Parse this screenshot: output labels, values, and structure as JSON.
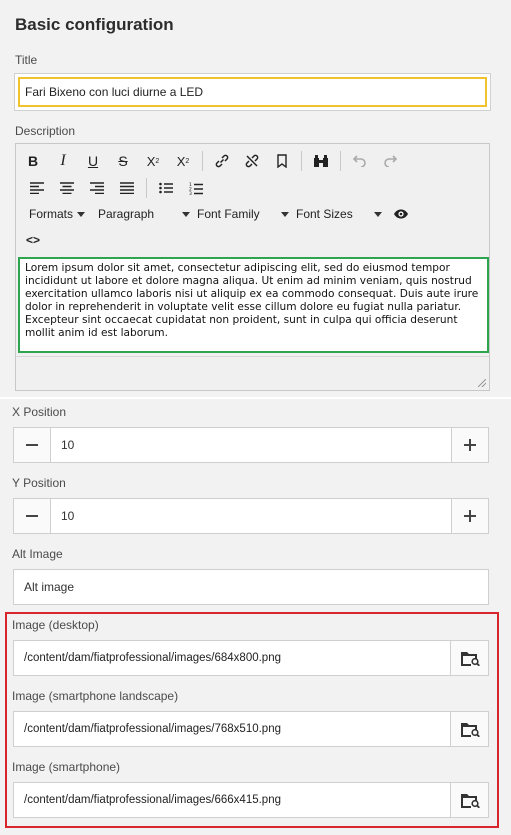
{
  "heading": "Basic configuration",
  "title_field": {
    "label": "Title",
    "value": "Fari Bixeno con luci diurne a LED"
  },
  "description": {
    "label": "Description",
    "toolbar": {
      "formats": "Formats",
      "paragraph": "Paragraph",
      "font_family": "Font Family",
      "font_sizes": "Font Sizes",
      "code": "<>"
    },
    "body": "Lorem ipsum dolor sit amet, consectetur adipiscing elit, sed do eiusmod tempor incididunt ut labore et dolore magna aliqua. Ut enim ad minim veniam, quis nostrud exercitation ullamco laboris nisi ut aliquip ex ea commodo consequat. Duis aute irure dolor in reprehenderit in voluptate velit esse cillum dolore eu fugiat nulla pariatur. Excepteur sint occaecat cupidatat non proident, sunt in culpa qui officia deserunt mollit anim id est laborum."
  },
  "x_position": {
    "label": "X Position",
    "value": "10"
  },
  "y_position": {
    "label": "Y Position",
    "value": "10"
  },
  "alt_image": {
    "label": "Alt Image",
    "value": "Alt image"
  },
  "images": [
    {
      "label": "Image (desktop)",
      "value": "/content/dam/fiatprofessional/images/684x800.png"
    },
    {
      "label": "Image (smartphone landscape)",
      "value": "/content/dam/fiatprofessional/images/768x510.png"
    },
    {
      "label": "Image (smartphone)",
      "value": "/content/dam/fiatprofessional/images/666x415.png"
    }
  ],
  "colors": {
    "title_highlight": "#f2c12e",
    "description_highlight": "#2da44e",
    "images_highlight": "#d7262e"
  }
}
